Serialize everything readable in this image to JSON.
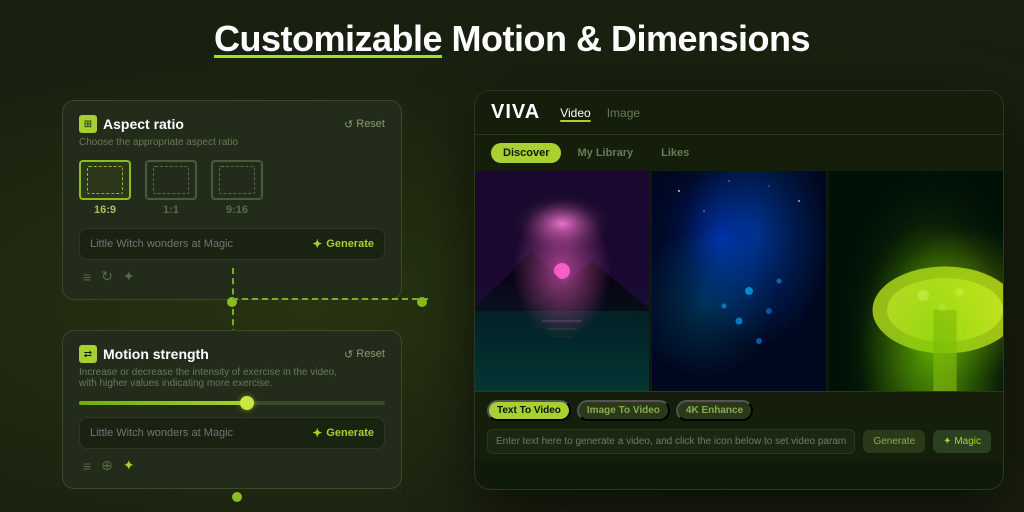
{
  "page": {
    "title_prefix": "Customizable",
    "title_suffix": " Motion & Dimensions",
    "background_color": "#1a2010"
  },
  "aspect_card": {
    "title": "Aspect ratio",
    "subtitle": "Choose the appropriate aspect ratio",
    "reset_label": "Reset",
    "options": [
      {
        "label": "16:9",
        "active": true
      },
      {
        "label": "1:1",
        "active": false
      },
      {
        "label": "9:16",
        "active": false
      }
    ],
    "input_placeholder": "Little Witch wonders at Magic",
    "generate_label": "Generate"
  },
  "motion_card": {
    "title": "Motion strength",
    "subtitle": "Increase or decrease the intensity of exercise in the video,\nwith higher values indicating more exercise.",
    "reset_label": "Reset",
    "slider_value": 55,
    "input_placeholder": "Little Witch wonders at Magic",
    "generate_label": "Generate"
  },
  "viva_panel": {
    "logo": "VIVA",
    "nav_items": [
      {
        "label": "Video",
        "active": true
      },
      {
        "label": "Image",
        "active": false
      }
    ],
    "tabs": [
      {
        "label": "Discover",
        "active": true
      },
      {
        "label": "My Library",
        "active": false
      },
      {
        "label": "Likes",
        "active": false
      }
    ],
    "bottom_tabs": [
      {
        "label": "Text To Video",
        "active": true
      },
      {
        "label": "Image To Video",
        "active": false
      },
      {
        "label": "4K Enhance",
        "active": false
      }
    ],
    "input_placeholder": "Enter text here to generate a video, and click the icon below to set video parameters",
    "generate_label": "Generate",
    "generate_btn_label": "✦ Magic"
  },
  "icons": {
    "reset": "↺",
    "generate_star": "✦",
    "aspect_icon": "⊞",
    "motion_icon": "⇄",
    "toolbar_eq": "≡",
    "toolbar_link": "⊕",
    "toolbar_magic": "✦"
  }
}
